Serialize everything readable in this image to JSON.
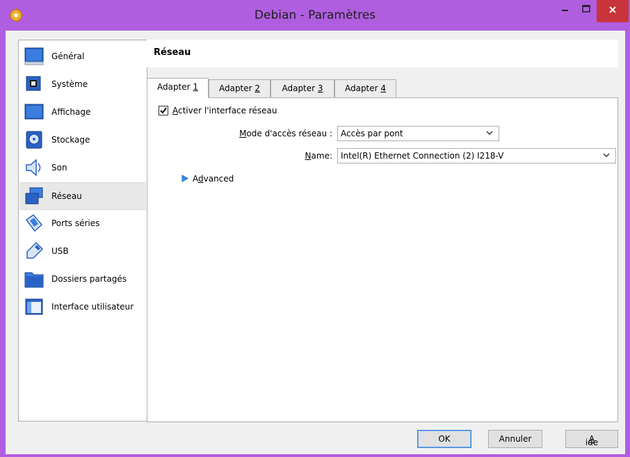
{
  "window": {
    "title": "Debian - Paramètres",
    "accent_color": "#b05ee0",
    "close_color": "#c8343b",
    "icons": {
      "app": "gear-icon",
      "minimize": "minimize-icon",
      "maximize": "maximize-icon",
      "close": "close-icon"
    }
  },
  "sidebar": {
    "items": [
      {
        "label": "Général",
        "icon": "general-icon"
      },
      {
        "label": "Système",
        "icon": "system-chip-icon"
      },
      {
        "label": "Affichage",
        "icon": "display-monitor-icon"
      },
      {
        "label": "Stockage",
        "icon": "storage-disk-icon"
      },
      {
        "label": "Son",
        "icon": "speaker-icon"
      },
      {
        "label": "Réseau",
        "icon": "network-icon",
        "selected": true
      },
      {
        "label": "Ports séries",
        "icon": "serial-port-icon"
      },
      {
        "label": "USB",
        "icon": "usb-icon"
      },
      {
        "label": "Dossiers partagés",
        "icon": "shared-folder-icon"
      },
      {
        "label": "Interface utilisateur",
        "icon": "user-interface-icon"
      }
    ]
  },
  "content": {
    "title": "Réseau",
    "tabs": [
      {
        "label": "Adapter ",
        "mnemonic": "1",
        "active": true
      },
      {
        "label": "Adapter ",
        "mnemonic": "2"
      },
      {
        "label": "Adapter ",
        "mnemonic": "3"
      },
      {
        "label": "Adapter ",
        "mnemonic": "4"
      }
    ],
    "enable_checkbox": {
      "mnemonic": "A",
      "label_rest": "ctiver l'interface réseau",
      "checked": true
    },
    "attached_to": {
      "label_mnemonic": "M",
      "label_rest": "ode d'accès réseau :",
      "value": "Accès par pont"
    },
    "name": {
      "label_mnemonic": "N",
      "label_rest": "ame:",
      "value": "Intel(R) Ethernet Connection (2) I218-V"
    },
    "advanced": {
      "label_start": "A",
      "label_mnemonic": "d",
      "label_rest": "vanced",
      "icon": "expand-triangle-icon"
    }
  },
  "buttons": {
    "ok": "OK",
    "cancel": "Annuler",
    "help_mnemonic": "A",
    "help_rest": "ide"
  }
}
